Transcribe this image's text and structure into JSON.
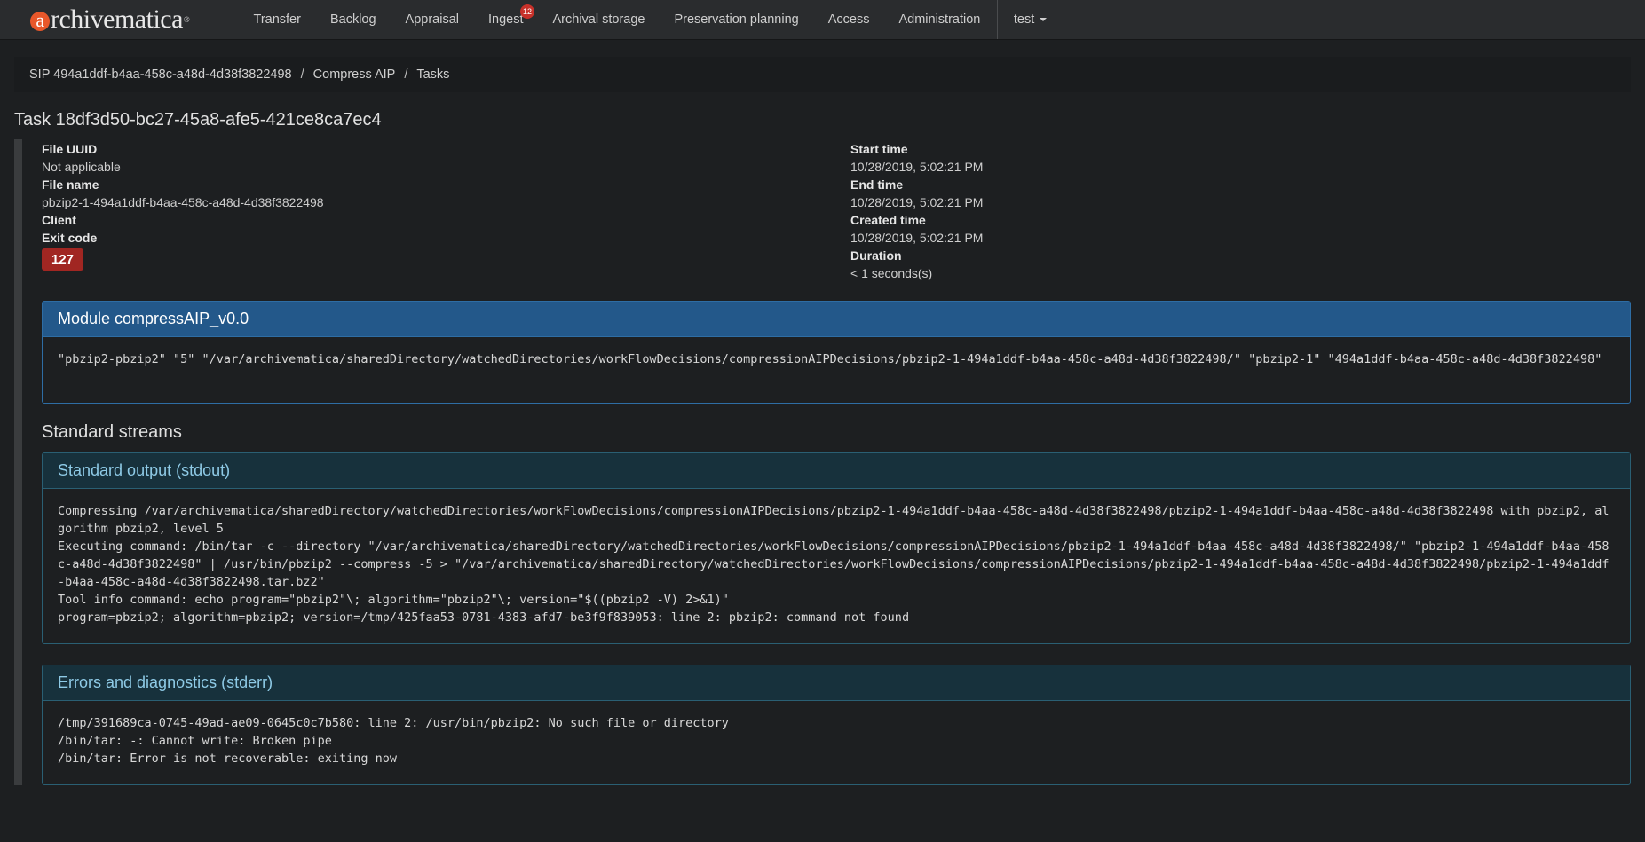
{
  "brand": {
    "logo_letter": "a",
    "logo_rest": "rchivematica",
    "logo_mark": "®"
  },
  "nav": {
    "items": [
      "Transfer",
      "Backlog",
      "Appraisal",
      "Ingest",
      "Archival storage",
      "Preservation planning",
      "Access",
      "Administration"
    ],
    "ingest_badge": "12",
    "user": "test"
  },
  "breadcrumb": [
    "SIP 494a1ddf-b4aa-458c-a48d-4d38f3822498",
    "Compress AIP",
    "Tasks"
  ],
  "breadcrumb_separator": "/",
  "task": {
    "title": "Task 18df3d50-bc27-45a8-afe5-421ce8ca7ec4",
    "file_uuid_label": "File UUID",
    "file_uuid": "Not applicable",
    "file_name_label": "File name",
    "file_name": "pbzip2-1-494a1ddf-b4aa-458c-a48d-4d38f3822498",
    "client_label": "Client",
    "client": "",
    "exit_code_label": "Exit code",
    "exit_code": "127",
    "start_time_label": "Start time",
    "start_time": "10/28/2019, 5:02:21 PM",
    "end_time_label": "End time",
    "end_time": "10/28/2019, 5:02:21 PM",
    "created_time_label": "Created time",
    "created_time": "10/28/2019, 5:02:21 PM",
    "duration_label": "Duration",
    "duration": "< 1 seconds(s)"
  },
  "module": {
    "title": "Module compressAIP_v0.0",
    "arguments": "\"pbzip2-pbzip2\" \"5\" \"/var/archivematica/sharedDirectory/watchedDirectories/workFlowDecisions/compressionAIPDecisions/pbzip2-1-494a1ddf-b4aa-458c-a48d-4d38f3822498/\" \"pbzip2-1\" \"494a1ddf-b4aa-458c-a48d-4d38f3822498\""
  },
  "streams": {
    "title": "Standard streams",
    "stdout_title": "Standard output (stdout)",
    "stdout": "Compressing /var/archivematica/sharedDirectory/watchedDirectories/workFlowDecisions/compressionAIPDecisions/pbzip2-1-494a1ddf-b4aa-458c-a48d-4d38f3822498/pbzip2-1-494a1ddf-b4aa-458c-a48d-4d38f3822498 with pbzip2, algorithm pbzip2, level 5\nExecuting command: /bin/tar -c --directory \"/var/archivematica/sharedDirectory/watchedDirectories/workFlowDecisions/compressionAIPDecisions/pbzip2-1-494a1ddf-b4aa-458c-a48d-4d38f3822498/\" \"pbzip2-1-494a1ddf-b4aa-458c-a48d-4d38f3822498\" | /usr/bin/pbzip2 --compress -5 > \"/var/archivematica/sharedDirectory/watchedDirectories/workFlowDecisions/compressionAIPDecisions/pbzip2-1-494a1ddf-b4aa-458c-a48d-4d38f3822498/pbzip2-1-494a1ddf-b4aa-458c-a48d-4d38f3822498.tar.bz2\"\nTool info command: echo program=\"pbzip2\"\\; algorithm=\"pbzip2\"\\; version=\"$((pbzip2 -V) 2>&1)\"\nprogram=pbzip2; algorithm=pbzip2; version=/tmp/425faa53-0781-4383-afd7-be3f9f839053: line 2: pbzip2: command not found",
    "stderr_title": "Errors and diagnostics (stderr)",
    "stderr": "/tmp/391689ca-0745-49ad-ae09-0645c0c7b580: line 2: /usr/bin/pbzip2: No such file or directory\n/bin/tar: -: Cannot write: Broken pipe\n/bin/tar: Error is not recoverable: exiting now"
  },
  "colors": {
    "background": "#1d1f21",
    "primary": "#23588a",
    "danger": "#a12622",
    "info_text": "#8ecae6",
    "logo_accent": "#e8572a"
  }
}
